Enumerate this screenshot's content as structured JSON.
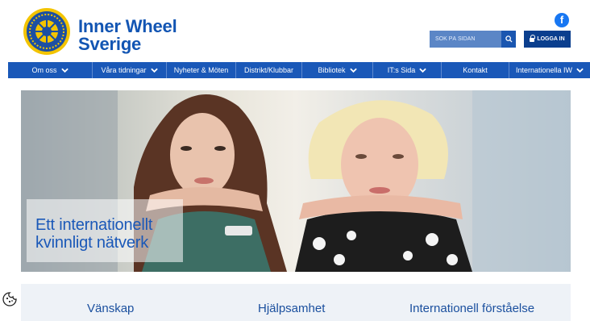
{
  "brand": {
    "line1": "Inner Wheel",
    "line2": "Sverige"
  },
  "social": {
    "facebook_glyph": "f",
    "facebook_color": "#1877f2"
  },
  "search": {
    "placeholder": "SÖK PÅ SIDAN"
  },
  "login": {
    "label": "LOGGA IN"
  },
  "nav": {
    "items": [
      {
        "label": "Om oss",
        "has_dropdown": true
      },
      {
        "label": "Våra tidningar",
        "has_dropdown": true
      },
      {
        "label": "Nyheter & Möten",
        "has_dropdown": false
      },
      {
        "label": "Distrikt/Klubbar",
        "has_dropdown": false
      },
      {
        "label": "Bibliotek",
        "has_dropdown": true
      },
      {
        "label": "IT:s Sida",
        "has_dropdown": true
      },
      {
        "label": "Kontakt",
        "has_dropdown": false
      },
      {
        "label": "Internationella IW",
        "has_dropdown": true
      }
    ]
  },
  "hero": {
    "caption_line1": "Ett internationellt",
    "caption_line2": "kvinnligt nätverk"
  },
  "values": {
    "col1": "Vänskap",
    "col2": "Hjälpsamhet",
    "col3": "Internationell förståelse"
  },
  "colors": {
    "primary": "#1a58b8",
    "dark": "#0b3f8e",
    "search_bg": "#5b86c6"
  }
}
